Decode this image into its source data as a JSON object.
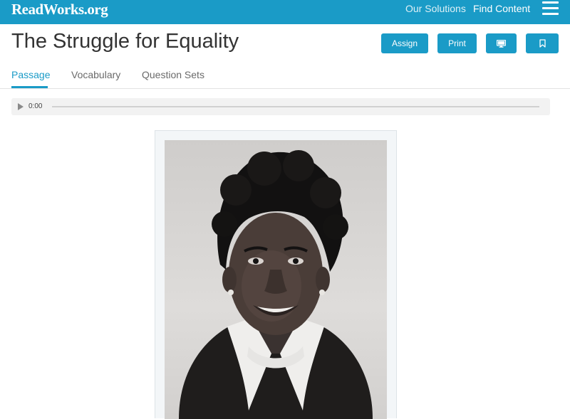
{
  "header": {
    "logo": "ReadWorks.org",
    "nav": {
      "our_solutions": "Our Solutions",
      "find_content": "Find Content"
    },
    "menu_icon": "hamburger-menu-icon"
  },
  "article": {
    "title": "The Struggle for Equality",
    "actions": {
      "assign": "Assign",
      "print": "Print",
      "present_icon": "monitor-icon",
      "bookmark_icon": "bookmark-icon"
    }
  },
  "tabs": {
    "passage": "Passage",
    "vocabulary": "Vocabulary",
    "question_sets": "Question Sets",
    "active": "Passage"
  },
  "audio": {
    "time": "0:00",
    "play_icon": "play-icon",
    "progress": 0
  },
  "colors": {
    "brand": "#1a9bc7",
    "title_text": "#333333",
    "tab_inactive": "#6a6a6a"
  }
}
